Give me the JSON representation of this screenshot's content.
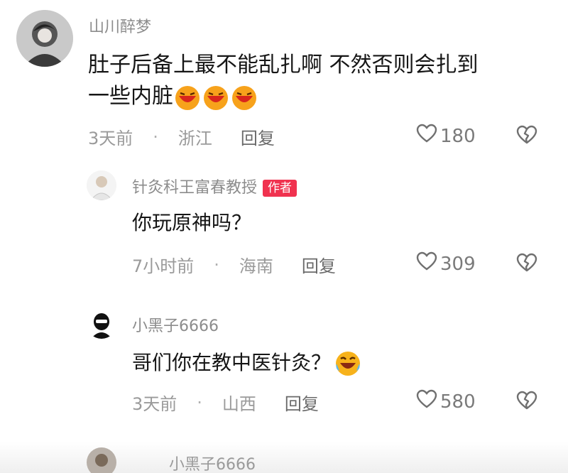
{
  "comments": [
    {
      "username": "山川醉梦",
      "line1": "肚子后备上最不能乱扎啊  不然否则会扎到",
      "line2": "一些内脏",
      "time": "3天前",
      "location": "浙江",
      "reply": "回复",
      "likes": "180"
    },
    {
      "username": "针灸科王富春教授",
      "badge": "作者",
      "text": "你玩原神吗？",
      "time": "7小时前",
      "location": "海南",
      "reply": "回复",
      "likes": "309"
    },
    {
      "username": "小黑子6666",
      "text": "哥们你在教中医针灸？",
      "time": "3天前",
      "location": "山西",
      "reply": "回复",
      "likes": "580"
    }
  ],
  "partial_next": {
    "username": "小黑子6666"
  },
  "icons": {
    "like": "heart-outline-icon",
    "dislike": "broken-heart-icon"
  },
  "colors": {
    "badge": "#f0324f",
    "username": "#8c8c8c",
    "meta": "#9a9a9a"
  }
}
